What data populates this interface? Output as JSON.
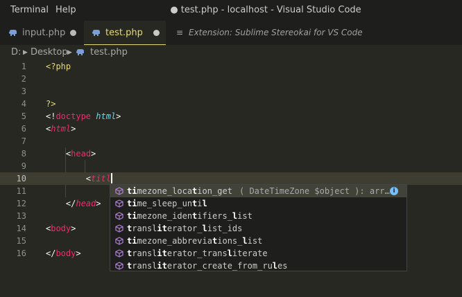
{
  "titlebar": {
    "menu": [
      "Terminal",
      "Help"
    ],
    "window_title": "● test.php - localhost - Visual Studio Code"
  },
  "tabs": [
    {
      "label": "input.php",
      "icon": "php-elephant-icon",
      "state": "inactive",
      "modified": true
    },
    {
      "label": "test.php",
      "icon": "php-elephant-icon",
      "state": "active",
      "modified": true
    },
    {
      "label": "Extension: Sublime Stereokai for VS Code",
      "icon": "extension-lines-icon",
      "state": "inactive",
      "modified": false
    }
  ],
  "breadcrumb": {
    "drive": "D:",
    "folder": "Desktop",
    "file": "test.php"
  },
  "editor": {
    "current_line": 10,
    "lines": [
      {
        "n": "1",
        "text": "<?php"
      },
      {
        "n": "2",
        "text": ""
      },
      {
        "n": "3",
        "text": ""
      },
      {
        "n": "4",
        "text": "?>"
      },
      {
        "n": "5",
        "text": "<!doctype html>"
      },
      {
        "n": "6",
        "text": "<html>"
      },
      {
        "n": "7",
        "text": ""
      },
      {
        "n": "8",
        "text": "    <head>"
      },
      {
        "n": "9",
        "text": ""
      },
      {
        "n": "10",
        "text": "        <titl"
      },
      {
        "n": "11",
        "text": ""
      },
      {
        "n": "12",
        "text": "    </head>"
      },
      {
        "n": "13",
        "text": ""
      },
      {
        "n": "14",
        "text": "<body>"
      },
      {
        "n": "15",
        "text": ""
      },
      {
        "n": "16",
        "text": "</body>"
      }
    ]
  },
  "suggest": {
    "items": [
      {
        "label": "timezone_location_get",
        "detail": "( DateTimeZone $object ): arr…",
        "selected": true
      },
      {
        "label": "time_sleep_until",
        "detail": "",
        "selected": false
      },
      {
        "label": "timezone_identifiers_list",
        "detail": "",
        "selected": false
      },
      {
        "label": "transliterator_list_ids",
        "detail": "",
        "selected": false
      },
      {
        "label": "timezone_abbreviations_list",
        "detail": "",
        "selected": false
      },
      {
        "label": "transliterator_transliterate",
        "detail": "",
        "selected": false
      },
      {
        "label": "transliterator_create_from_rules",
        "detail": "",
        "selected": false
      }
    ],
    "item_icon": "method-cube-icon",
    "info_icon": "info-icon",
    "info_glyph": "i"
  },
  "colors": {
    "background": "#272822",
    "tag": "#f92672",
    "php": "#e6db74",
    "attr_italic": "#66d9ef",
    "method_icon": "#b180d7",
    "suggest_selected": "#414339"
  }
}
